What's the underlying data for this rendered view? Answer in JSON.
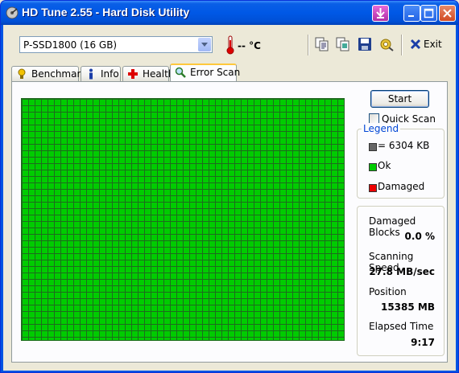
{
  "window": {
    "title": "HD Tune 2.55 - Hard Disk Utility"
  },
  "toolbar": {
    "drive": "P-SSD1800 (16 GB)",
    "temperature": "-- °C",
    "exit_label": "Exit"
  },
  "tabs": [
    {
      "label": "Benchmark",
      "active": false
    },
    {
      "label": "Info",
      "active": false
    },
    {
      "label": "Health",
      "active": false
    },
    {
      "label": "Error Scan",
      "active": true
    }
  ],
  "scan": {
    "start_label": "Start",
    "quick_scan_label": "Quick Scan",
    "quick_scan_checked": false,
    "block_status": "ok"
  },
  "legend": {
    "title": "Legend",
    "block_size": "= 6304 KB",
    "ok": "Ok",
    "damaged": "Damaged"
  },
  "stats": {
    "damaged_blocks_label": "Damaged Blocks",
    "damaged_blocks_value": "0.0 %",
    "scanning_speed_label": "Scanning Speed",
    "scanning_speed_value": "27.8 MB/sec",
    "position_label": "Position",
    "position_value": "15385 MB",
    "elapsed_label": "Elapsed Time",
    "elapsed_value": "9:17"
  },
  "colors": {
    "ok": "#00cc00",
    "damaged": "#ee0000",
    "grid_line": "#1e6b1e",
    "accent": "#0054e3"
  }
}
